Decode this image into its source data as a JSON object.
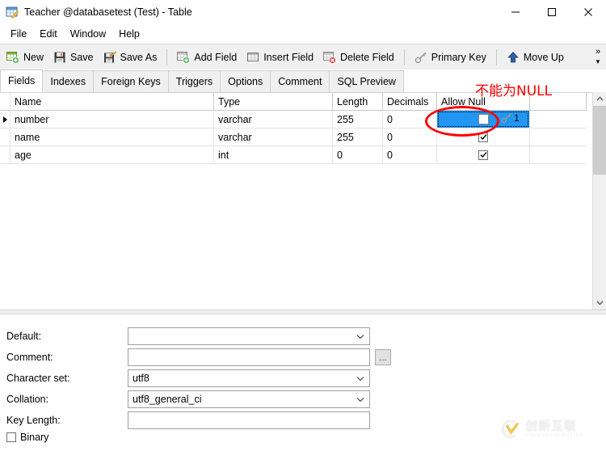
{
  "window": {
    "title": "Teacher @databasetest (Test) - Table",
    "icon": "table-edit-icon",
    "controls": {
      "minimize": "minimize-icon",
      "maximize": "maximize-icon",
      "close": "close-icon"
    }
  },
  "menubar": {
    "items": [
      {
        "label": "File"
      },
      {
        "label": "Edit"
      },
      {
        "label": "Window"
      },
      {
        "label": "Help"
      }
    ]
  },
  "toolbar": {
    "groups": [
      [
        {
          "label": "New",
          "icon": "new-table-icon"
        },
        {
          "label": "Save",
          "icon": "save-icon"
        },
        {
          "label": "Save As",
          "icon": "save-as-icon"
        }
      ],
      [
        {
          "label": "Add Field",
          "icon": "add-field-icon"
        },
        {
          "label": "Insert Field",
          "icon": "insert-field-icon"
        },
        {
          "label": "Delete Field",
          "icon": "delete-field-icon"
        }
      ],
      [
        {
          "label": "Primary Key",
          "icon": "key-icon"
        }
      ],
      [
        {
          "label": "Move Up",
          "icon": "arrow-up-icon"
        }
      ]
    ],
    "overflow": "toolbar-overflow-chevron"
  },
  "tabs": [
    {
      "label": "Fields",
      "active": true
    },
    {
      "label": "Indexes",
      "active": false
    },
    {
      "label": "Foreign Keys",
      "active": false
    },
    {
      "label": "Triggers",
      "active": false
    },
    {
      "label": "Options",
      "active": false
    },
    {
      "label": "Comment",
      "active": false
    },
    {
      "label": "SQL Preview",
      "active": false
    }
  ],
  "grid": {
    "columns": [
      "Name",
      "Type",
      "Length",
      "Decimals",
      "Allow Null"
    ],
    "rows": [
      {
        "current": true,
        "name": "number",
        "type": "varchar",
        "length": "255",
        "decimals": "0",
        "allow_null": false,
        "selected": true,
        "key_badge": "1"
      },
      {
        "current": false,
        "name": "name",
        "type": "varchar",
        "length": "255",
        "decimals": "0",
        "allow_null": true,
        "selected": false,
        "key_badge": ""
      },
      {
        "current": false,
        "name": "age",
        "type": "int",
        "length": "0",
        "decimals": "0",
        "allow_null": true,
        "selected": false,
        "key_badge": ""
      }
    ]
  },
  "properties": {
    "default": {
      "label": "Default:",
      "value": "",
      "type": "combobox"
    },
    "comment": {
      "label": "Comment:",
      "value": "",
      "type": "text",
      "browse_label": "..."
    },
    "character_set": {
      "label": "Character set:",
      "value": "utf8",
      "type": "combobox"
    },
    "collation": {
      "label": "Collation:",
      "value": "utf8_general_ci",
      "type": "combobox"
    },
    "key_length": {
      "label": "Key Length:",
      "value": "",
      "type": "text"
    },
    "binary": {
      "label": "Binary",
      "checked": false
    }
  },
  "annotation": {
    "text": "不能为NULL",
    "color": "#ff0000",
    "shape": "ellipse"
  },
  "watermark": {
    "cn": "创新互联",
    "en": "CHUANGXIN HULIAN"
  },
  "colors": {
    "selection_blue": "#2196f3",
    "toolbar_bg": "#f0f0f0",
    "annotation_red": "#ff0000"
  }
}
